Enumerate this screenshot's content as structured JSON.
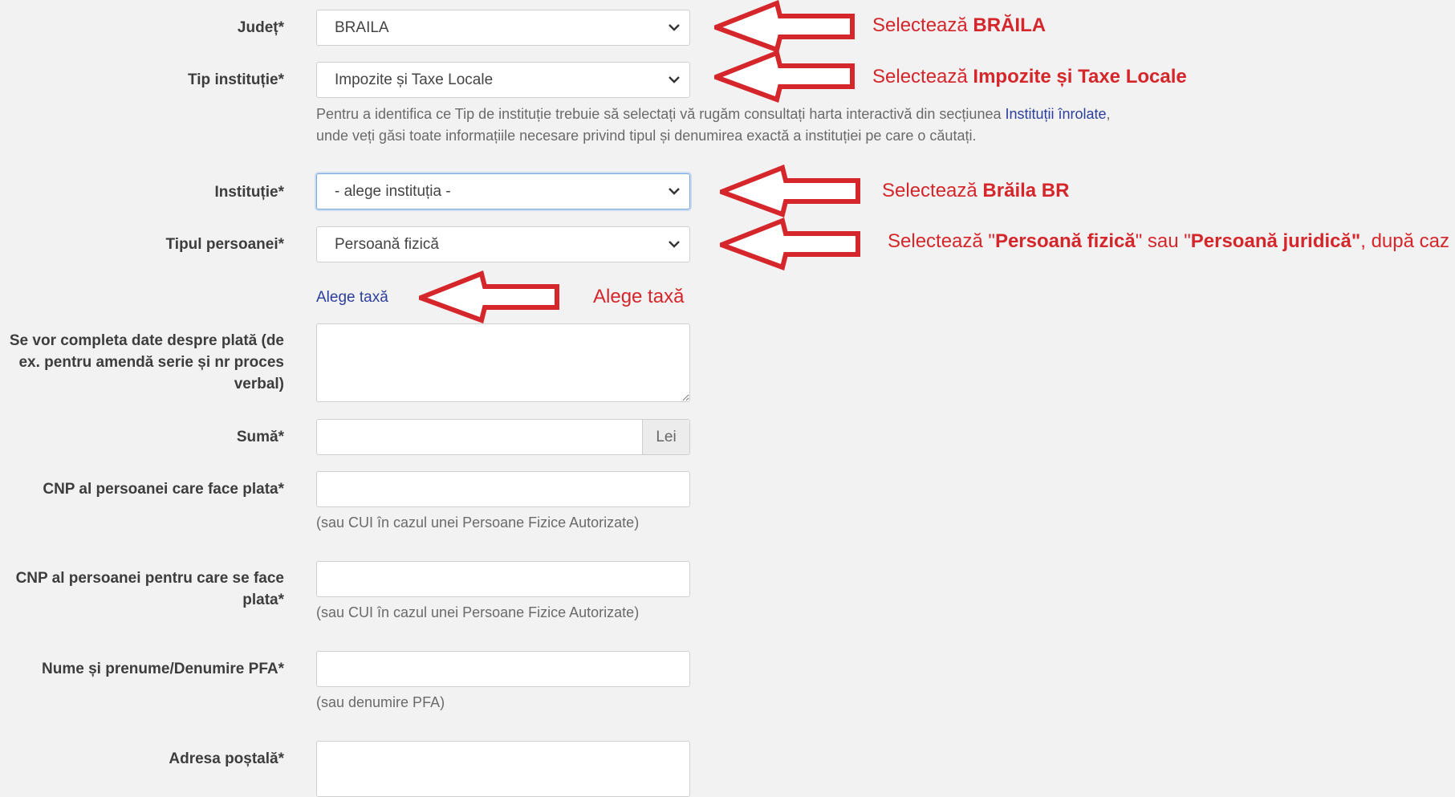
{
  "form": {
    "judet": {
      "label": "Județ*",
      "value": "BRAILA"
    },
    "tip_institutie": {
      "label": "Tip instituție*",
      "value": "Impozite și Taxe Locale",
      "help_line1_before": "Pentru a identifica ce Tip de instituție trebuie să selectați vă rugăm consultați harta interactivă din secțiunea ",
      "help_link": "Instituții înrolate",
      "help_line1_after": ",",
      "help_line2": "unde veți găsi toate informațiile necesare privind tipul și denumirea exactă a instituției pe care o căutați."
    },
    "institutie": {
      "label": "Instituție*",
      "value": "- alege instituția -"
    },
    "tipul_persoanei": {
      "label": "Tipul persoanei*",
      "value": "Persoană fizică"
    },
    "alege_taxa_link": "Alege taxă",
    "detalii_plata": {
      "label_line1": "Se vor completa date despre plată (de",
      "label_line2": "ex. pentru amendă serie și nr proces",
      "label_line3": "verbal)",
      "value": ""
    },
    "suma": {
      "label": "Sumă*",
      "value": "",
      "addon": "Lei"
    },
    "cnp_platitor": {
      "label": "CNP al persoanei care face plata*",
      "value": "",
      "help": "(sau CUI în cazul unei Persoane Fizice Autorizate)"
    },
    "cnp_beneficiar": {
      "label_line1": "CNP al persoanei pentru care se face",
      "label_line2": "plata*",
      "value": "",
      "help": "(sau CUI în cazul unei Persoane Fizice Autorizate)"
    },
    "nume": {
      "label": "Nume și prenume/Denumire PFA*",
      "value": "",
      "help": "(sau denumire PFA)"
    },
    "adresa": {
      "label": "Adresa poștală*",
      "value": ""
    }
  },
  "annotations": {
    "judet": {
      "prefix": "Selectează ",
      "bold": "BRĂILA"
    },
    "tip": {
      "prefix": "Selectează ",
      "bold": "Impozite și Taxe Locale"
    },
    "institutie": {
      "prefix": "Selectează ",
      "bold": "Brăila BR"
    },
    "persoana": {
      "prefix": "Selectează \"",
      "bold1": "Persoană fizică",
      "mid": "\" sau \"",
      "bold2": "Persoană juridică\"",
      "suffix": ", după caz"
    },
    "taxa": "Alege taxă",
    "color": "#d4262b"
  }
}
